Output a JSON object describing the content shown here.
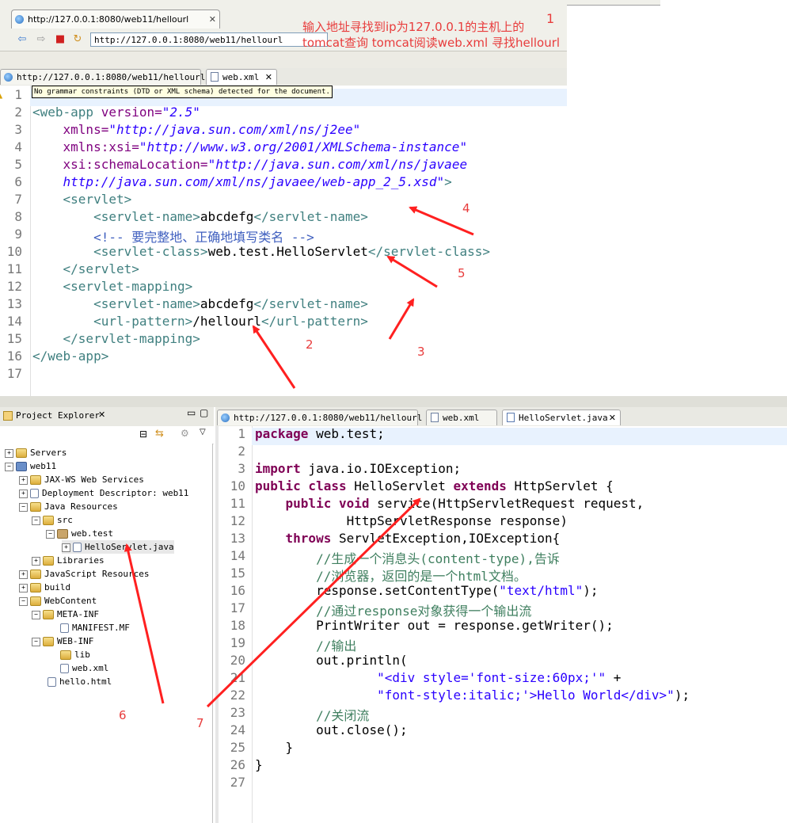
{
  "browser": {
    "tab_url": "http://127.0.0.1:8080/web11/hellourl",
    "address": "http://127.0.0.1:8080/web11/hellourl",
    "annotation_lines": [
      "输入地址寻找到ip为127.0.0.1的主机上的",
      "tomcat查询 tomcat阅读web.xml 寻找hellourl"
    ]
  },
  "xml_editor": {
    "tabs": [
      {
        "label": "http://127.0.0.1:8080/web11/hellourl"
      },
      {
        "label": "web.xml"
      }
    ],
    "tooltip": "No grammar constraints (DTD or XML schema) detected for the document.",
    "line_numbers": [
      "1",
      "2",
      "3",
      "4",
      "5",
      "6",
      "7",
      "8",
      "9",
      "10",
      "11",
      "12",
      "13",
      "14",
      "15",
      "16",
      "17"
    ],
    "lines": {
      "l2a": "<web-app",
      "l2b": " version=",
      "l2c": "\"2.5\"",
      "l3a": "    xmlns=",
      "l3b": "\"http://java.sun.com/xml/ns/j2ee\"",
      "l4a": "    xmlns:xsi=",
      "l4b": "\"http://www.w3.org/2001/XMLSchema-instance\"",
      "l5a": "    xsi:schemaLocation=",
      "l5b": "\"http://java.sun.com/xml/ns/javaee",
      "l6a": "    http://java.sun.com/xml/ns/javaee/web-app_2_5.xsd\"",
      "l6b": ">",
      "l7": "    <servlet>",
      "l8a": "        <servlet-name>",
      "l8b": "abcdefg",
      "l8c": "</servlet-name>",
      "l9": "        <!-- 要完整地、正确地填写类名 -->",
      "l10a": "        <servlet-class>",
      "l10b": "web.test.HelloServlet",
      "l10c": "</servlet-class>",
      "l11": "    </servlet>",
      "l12": "    <servlet-mapping>",
      "l13a": "        <servlet-name>",
      "l13b": "abcdefg",
      "l13c": "</servlet-name>",
      "l14a": "        <url-pattern>",
      "l14b": "/hellourl",
      "l14c": "</url-pattern>",
      "l15": "    </servlet-mapping>",
      "l16": "</web-app>"
    }
  },
  "explorer": {
    "title": "Project Explorer",
    "items": [
      {
        "label": "Servers"
      },
      {
        "label": "web11"
      },
      {
        "label": "JAX-WS Web Services"
      },
      {
        "label": "Deployment Descriptor: web11"
      },
      {
        "label": "Java Resources"
      },
      {
        "label": "src"
      },
      {
        "label": "web.test"
      },
      {
        "label": "HelloServlet.java"
      },
      {
        "label": "Libraries"
      },
      {
        "label": "JavaScript Resources"
      },
      {
        "label": "build"
      },
      {
        "label": "WebContent"
      },
      {
        "label": "META-INF"
      },
      {
        "label": "MANIFEST.MF"
      },
      {
        "label": "WEB-INF"
      },
      {
        "label": "lib"
      },
      {
        "label": "web.xml"
      },
      {
        "label": "hello.html"
      }
    ]
  },
  "java_editor": {
    "tabs": [
      {
        "label": "http://127.0.0.1:8080/web11/hellourl"
      },
      {
        "label": "web.xml"
      },
      {
        "label": "HelloServlet.java"
      }
    ],
    "line_numbers": [
      "1",
      "2",
      "3",
      "10",
      "11",
      "12",
      "13",
      "14",
      "15",
      "16",
      "17",
      "18",
      "19",
      "20",
      "21",
      "22",
      "23",
      "24",
      "25",
      "26",
      "27"
    ],
    "lines": {
      "j1a": "package",
      "j1b": " web.test;",
      "j3a": "import",
      "j3b": " java.io.IOException;",
      "j10a": "public class",
      "j10b": " HelloServlet ",
      "j10c": "extends",
      "j10d": " HttpServlet {",
      "j11a": "    public void",
      "j11b": " service(HttpServletRequest request,",
      "j12": "            HttpServletResponse response)",
      "j13a": "    throws",
      "j13b": " ServletException,IOException{",
      "j14": "        //生成一个消息头(content-type),告诉",
      "j15": "        //浏览器，返回的是一个html文档。",
      "j16a": "        response.setContentType(",
      "j16b": "\"text/html\"",
      "j16c": ");",
      "j17": "        //通过response对象获得一个输出流",
      "j18": "        PrintWriter out = response.getWriter();",
      "j19": "        //输出",
      "j20": "        out.println(",
      "j21a": "                ",
      "j21b": "\"<div style='font-size:60px;'\"",
      "j21c": " +",
      "j22a": "                ",
      "j22b": "\"font-style:italic;'>Hello World</div>\"",
      "j22c": ");",
      "j23": "        //关闭流",
      "j24": "        out.close();",
      "j25": "    }",
      "j26": "}"
    }
  },
  "markers": [
    "1",
    "2",
    "3",
    "4",
    "5",
    "6",
    "7"
  ]
}
